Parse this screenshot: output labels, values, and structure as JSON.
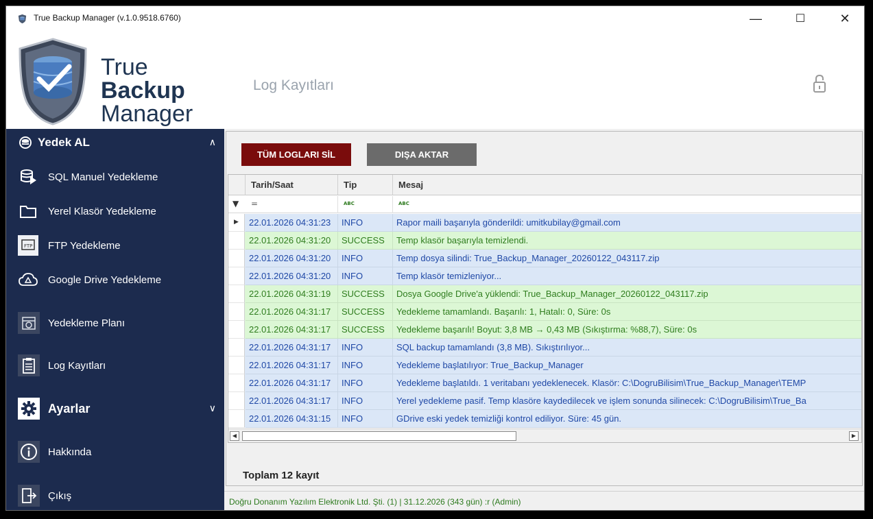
{
  "window": {
    "title": "True Backup Manager (v.1.0.9518.6760)",
    "minimize": "—",
    "maximize": "☐",
    "close": "✕"
  },
  "logo": {
    "line1": "True",
    "line2": "Backup",
    "line3": "Manager"
  },
  "header": {
    "page_title": "Log Kayıtları"
  },
  "sidebar": {
    "section_backup": "Yedek AL",
    "items": [
      {
        "label": "SQL Manuel Yedekleme",
        "icon": "database-play-icon"
      },
      {
        "label": "Yerel Klasör Yedekleme",
        "icon": "folder-icon"
      },
      {
        "label": "FTP Yedekleme",
        "icon": "ftp-icon"
      },
      {
        "label": "Google Drive Yedekleme",
        "icon": "google-drive-icon"
      },
      {
        "label": "Yedekleme Planı",
        "icon": "schedule-icon"
      },
      {
        "label": "Log Kayıtları",
        "icon": "clipboard-icon"
      }
    ],
    "section_settings": "Ayarlar",
    "about": "Hakkında",
    "exit": "Çıkış"
  },
  "toolbar": {
    "delete_all": "TÜM LOGLARI SİL",
    "export": "DIŞA AKTAR"
  },
  "grid": {
    "columns": {
      "datetime": "Tarih/Saat",
      "type": "Tip",
      "message": "Mesaj"
    },
    "filter_equals": "=",
    "filter_abc": "ABC",
    "rows": [
      {
        "datetime": "22.01.2026 04:31:23",
        "type": "INFO",
        "message": "Rapor maili başarıyla gönderildi: umitkubilay@gmail.com"
      },
      {
        "datetime": "22.01.2026 04:31:20",
        "type": "SUCCESS",
        "message": "Temp klasör başarıyla temizlendi."
      },
      {
        "datetime": "22.01.2026 04:31:20",
        "type": "INFO",
        "message": "Temp dosya silindi: True_Backup_Manager_20260122_043117.zip"
      },
      {
        "datetime": "22.01.2026 04:31:20",
        "type": "INFO",
        "message": "Temp klasör temizleniyor..."
      },
      {
        "datetime": "22.01.2026 04:31:19",
        "type": "SUCCESS",
        "message": "Dosya Google Drive'a yüklendi: True_Backup_Manager_20260122_043117.zip"
      },
      {
        "datetime": "22.01.2026 04:31:17",
        "type": "SUCCESS",
        "message": "Yedekleme tamamlandı. Başarılı: 1, Hatalı: 0, Süre: 0s"
      },
      {
        "datetime": "22.01.2026 04:31:17",
        "type": "SUCCESS",
        "message": "Yedekleme başarılı! Boyut: 3,8 MB → 0,43 MB (Sıkıştırma: %88,7), Süre: 0s"
      },
      {
        "datetime": "22.01.2026 04:31:17",
        "type": "INFO",
        "message": "SQL backup tamamlandı (3,8 MB). Sıkıştırılıyor..."
      },
      {
        "datetime": "22.01.2026 04:31:17",
        "type": "INFO",
        "message": "Yedekleme başlatılıyor: True_Backup_Manager"
      },
      {
        "datetime": "22.01.2026 04:31:17",
        "type": "INFO",
        "message": "Yedekleme başlatıldı. 1 veritabanı yedeklenecek. Klasör: C:\\DogruBilisim\\True_Backup_Manager\\TEMP"
      },
      {
        "datetime": "22.01.2026 04:31:17",
        "type": "INFO",
        "message": "Yerel yedekleme pasif. Temp klasöre kaydedilecek ve işlem sonunda silinecek: C:\\DogruBilisim\\True_Ba"
      },
      {
        "datetime": "22.01.2026 04:31:15",
        "type": "INFO",
        "message": "GDrive eski yedek temizliği kontrol ediliyor. Süre: 45 gün."
      }
    ]
  },
  "summary": {
    "total": "Toplam 12 kayıt"
  },
  "status": {
    "text": "Doğru Donanım Yazılım Elektronik Ltd. Şti. (1)  |  31.12.2026  (343 gün) :r  (Admin)"
  },
  "colors": {
    "sidebar": "#1c2b4e",
    "delete_btn": "#7a0c0c",
    "export_btn": "#6b6b6b",
    "info_row": "#dbe7f7",
    "success_row": "#dcf7d5"
  }
}
